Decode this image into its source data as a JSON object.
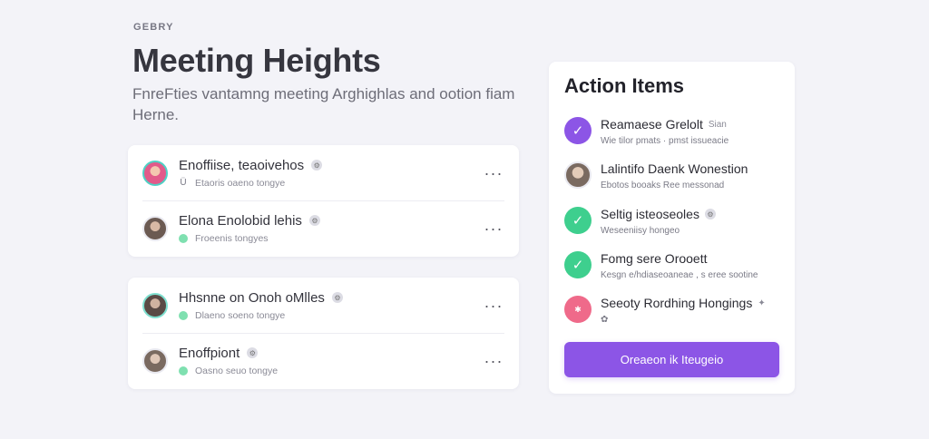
{
  "header": {
    "eyebrow": "GEBRY",
    "title": "Meeting Heights",
    "subtitle": "FnreFties vantamng meeting Arghighlas and ootion fiam Herne."
  },
  "meetings_group_1": [
    {
      "title": "Enoffiise, teaoivehos",
      "meta_icon": "Ü",
      "meta": "Etaoris oaeno tongye",
      "avatar_color": "#e25a8a",
      "avatar_ring": "#4fd1c5"
    },
    {
      "title": "Elona Enolobid lehis",
      "meta_icon": "",
      "meta": "Froeenis tongyes",
      "avatar_color": "#6b5a52",
      "avatar_ring": "#e9e9f0"
    }
  ],
  "meetings_group_2": [
    {
      "title": "Hhsnne on Onoh oMlles",
      "meta_icon": "",
      "meta": "Dlaeno soeno tongye",
      "avatar_color": "#5a4a45",
      "avatar_ring": "#7fe0d0"
    },
    {
      "title": "Enoffpiont",
      "meta_icon": "",
      "meta": "Oasno seuo tongye",
      "avatar_color": "#7a6a60",
      "avatar_ring": "#e9e9f0"
    }
  ],
  "panel": {
    "title": "Action Items",
    "items": [
      {
        "title": "Reamaese Grelolt",
        "suffix": "Sian",
        "meta": "Wie tilor pmats · pmst issueacie",
        "status": "purple-check",
        "color": "#8c55e6"
      },
      {
        "title": "Lalintifo Daenk Wonestion",
        "suffix": "",
        "meta": "Ebotos booaks Ree messonad",
        "status": "avatar",
        "color": "#7a6a60"
      },
      {
        "title": "Seltig isteoseoles",
        "suffix": "",
        "meta": "Weseeniisy hongeo",
        "status": "green-check",
        "color": "#3ecf8e"
      },
      {
        "title": "Fomg sere Orooett",
        "suffix": "",
        "meta": "Kesgn e/hdiaseoaneae , s eree sootine",
        "status": "green-check",
        "color": "#3ecf8e"
      },
      {
        "title": "Seeoty Rordhing Hongings",
        "suffix": "",
        "meta": "",
        "status": "pink-dot",
        "color": "#ef6a8a"
      }
    ],
    "button_label": "Oreaeon ik Iteugeio"
  },
  "icons": {
    "more": "more-icon",
    "check": "check-icon"
  }
}
